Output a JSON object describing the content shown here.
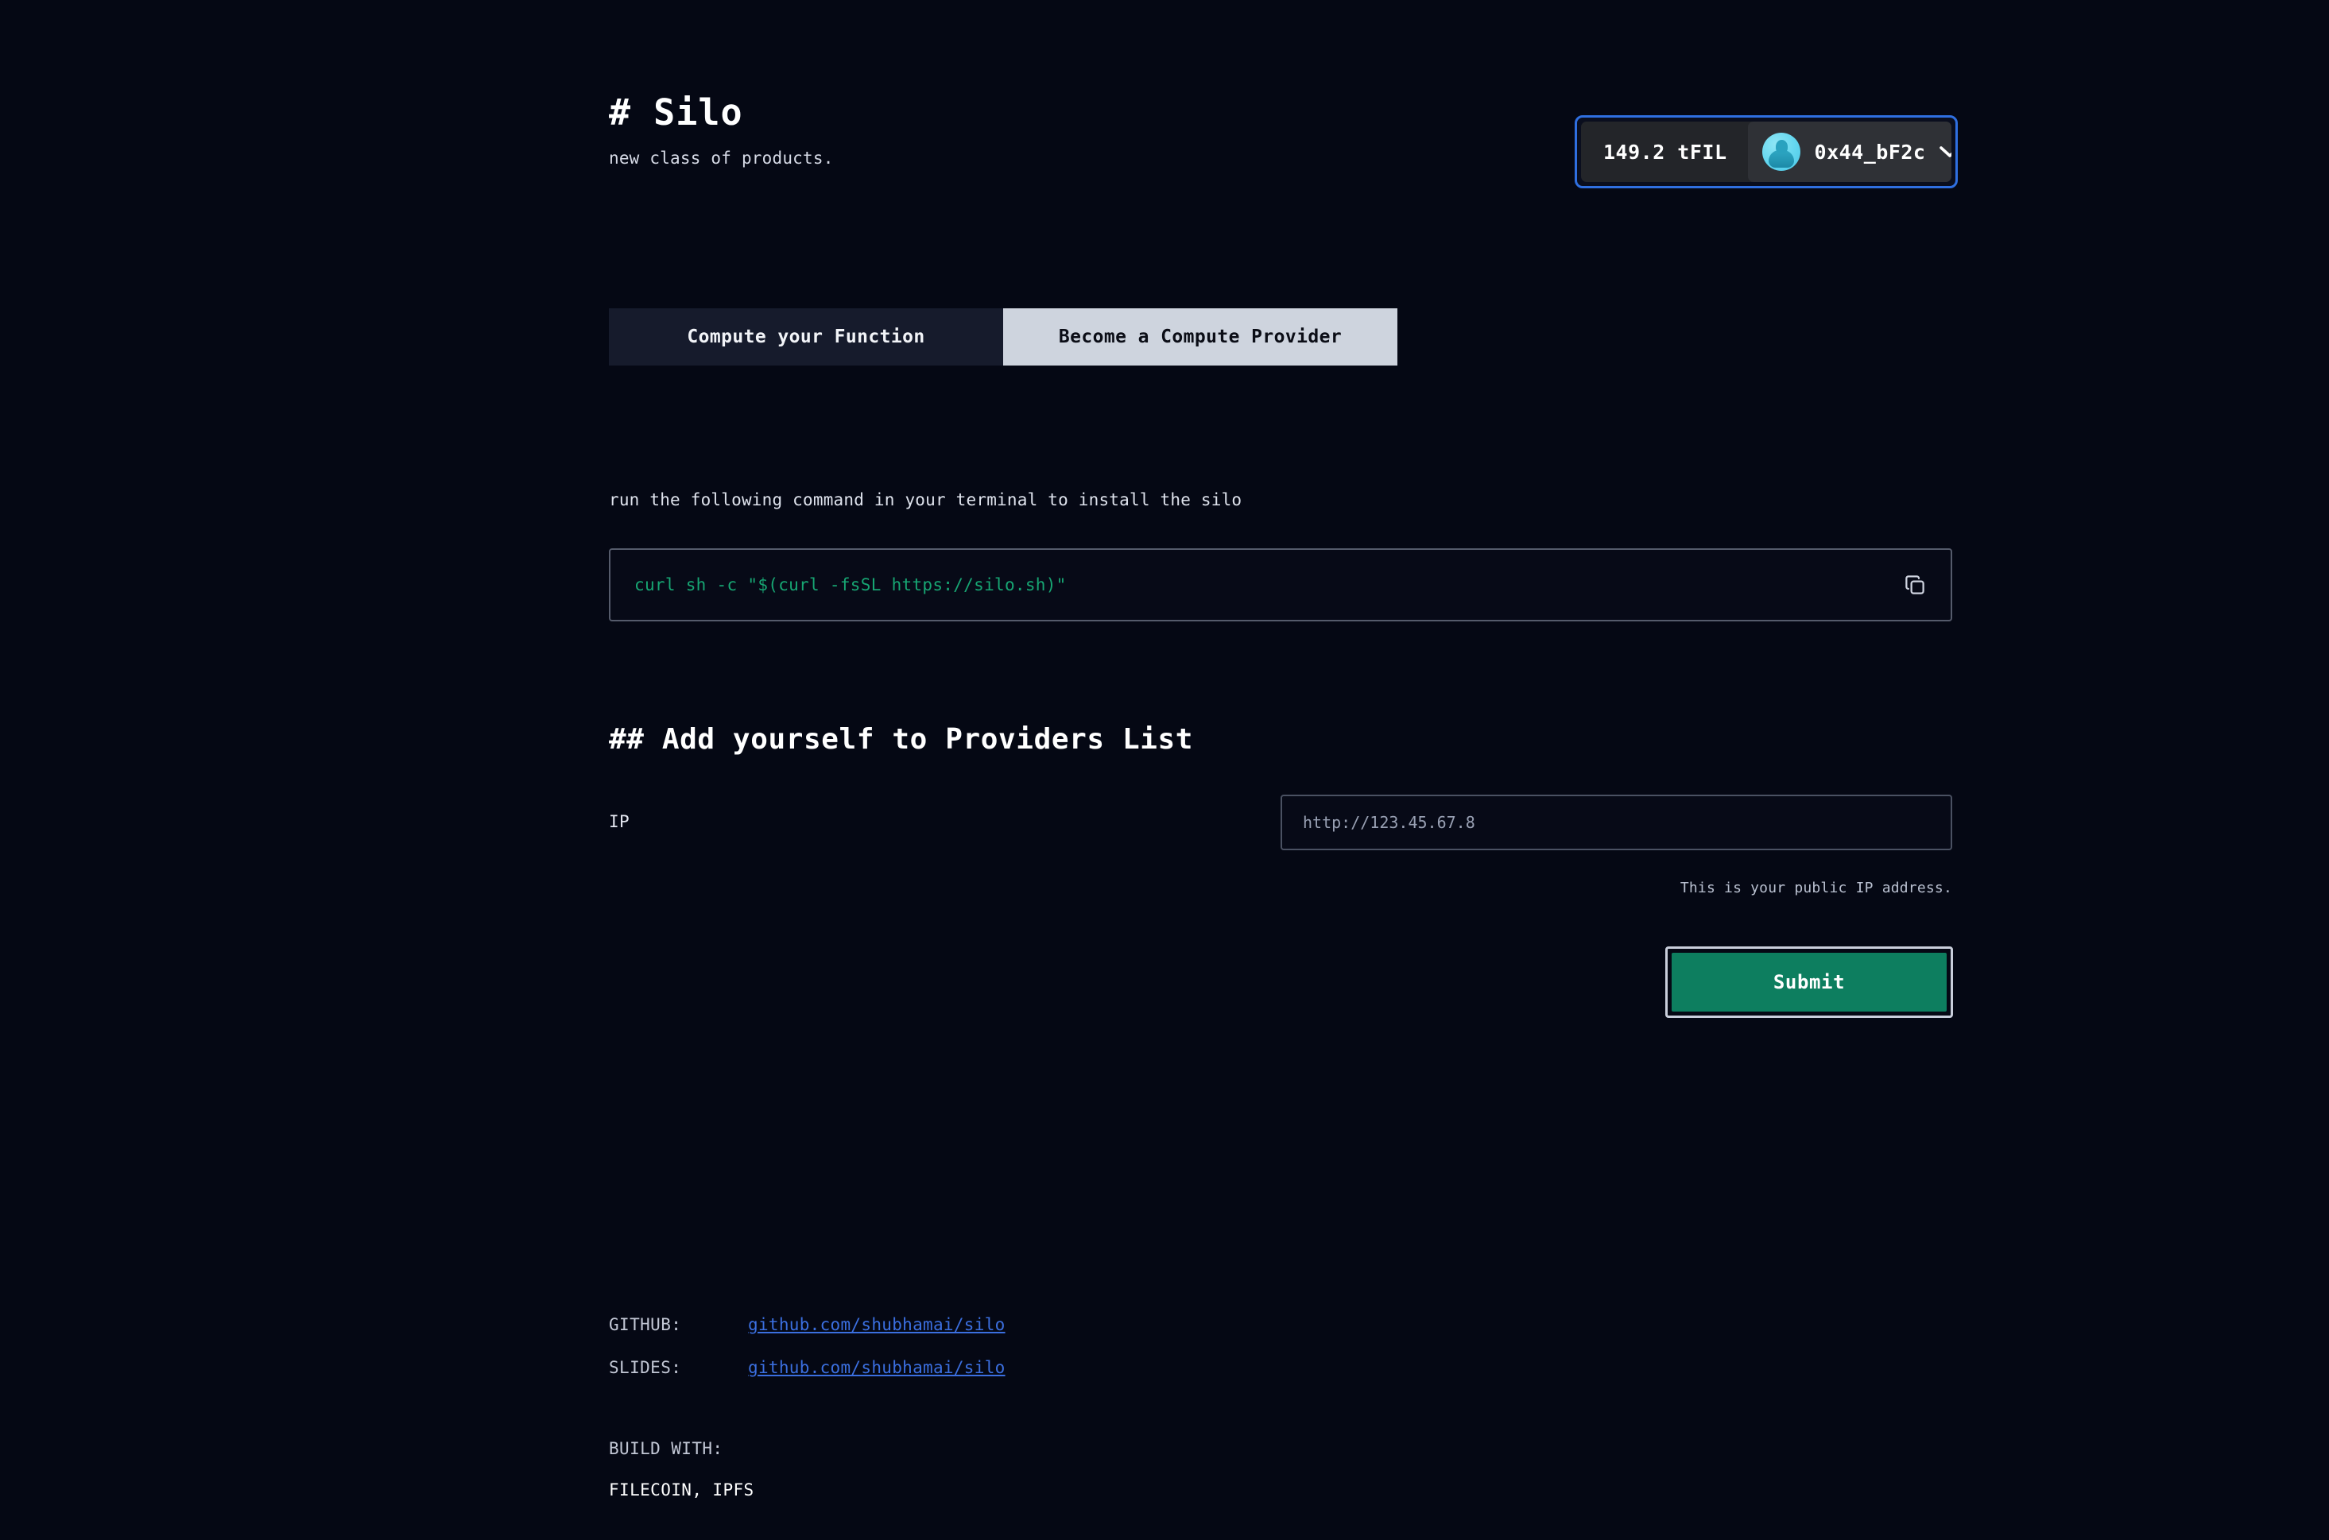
{
  "header": {
    "title": "# Silo",
    "subtitle": "new class of products."
  },
  "wallet": {
    "balance": "149.2 tFIL",
    "address": "0x44_bF2c",
    "avatar_icon": "whale-avatar-icon",
    "chevron_icon": "chevron-down-icon",
    "focus_ring_color": "#2f6fe0"
  },
  "tabs": [
    {
      "label": "Compute your Function",
      "active": false
    },
    {
      "label": "Become a Compute Provider",
      "active": true
    }
  ],
  "install": {
    "note": "run the following command in your terminal to install the silo",
    "command": "curl sh -c \"$(curl -fsSL https://silo.sh)\"",
    "command_color": "#17a673",
    "copy_icon": "copy-icon"
  },
  "providers": {
    "section_title": "## Add yourself to Providers List",
    "ip_label": "IP",
    "ip_value": "",
    "ip_placeholder": "http://123.45.67.8",
    "ip_hint": "This is your public IP address.",
    "submit_label": "Submit",
    "submit_color": "#0d7e5f"
  },
  "footer": {
    "rows": [
      {
        "key": "GITHUB:",
        "link": "github.com/shubhamai/silo"
      },
      {
        "key": "SLIDES:",
        "link": "github.com/shubhamai/silo"
      }
    ],
    "build_with_label": "BUILD WITH:",
    "build_stack": "FILECOIN, IPFS",
    "link_color": "#3b6fe0"
  }
}
